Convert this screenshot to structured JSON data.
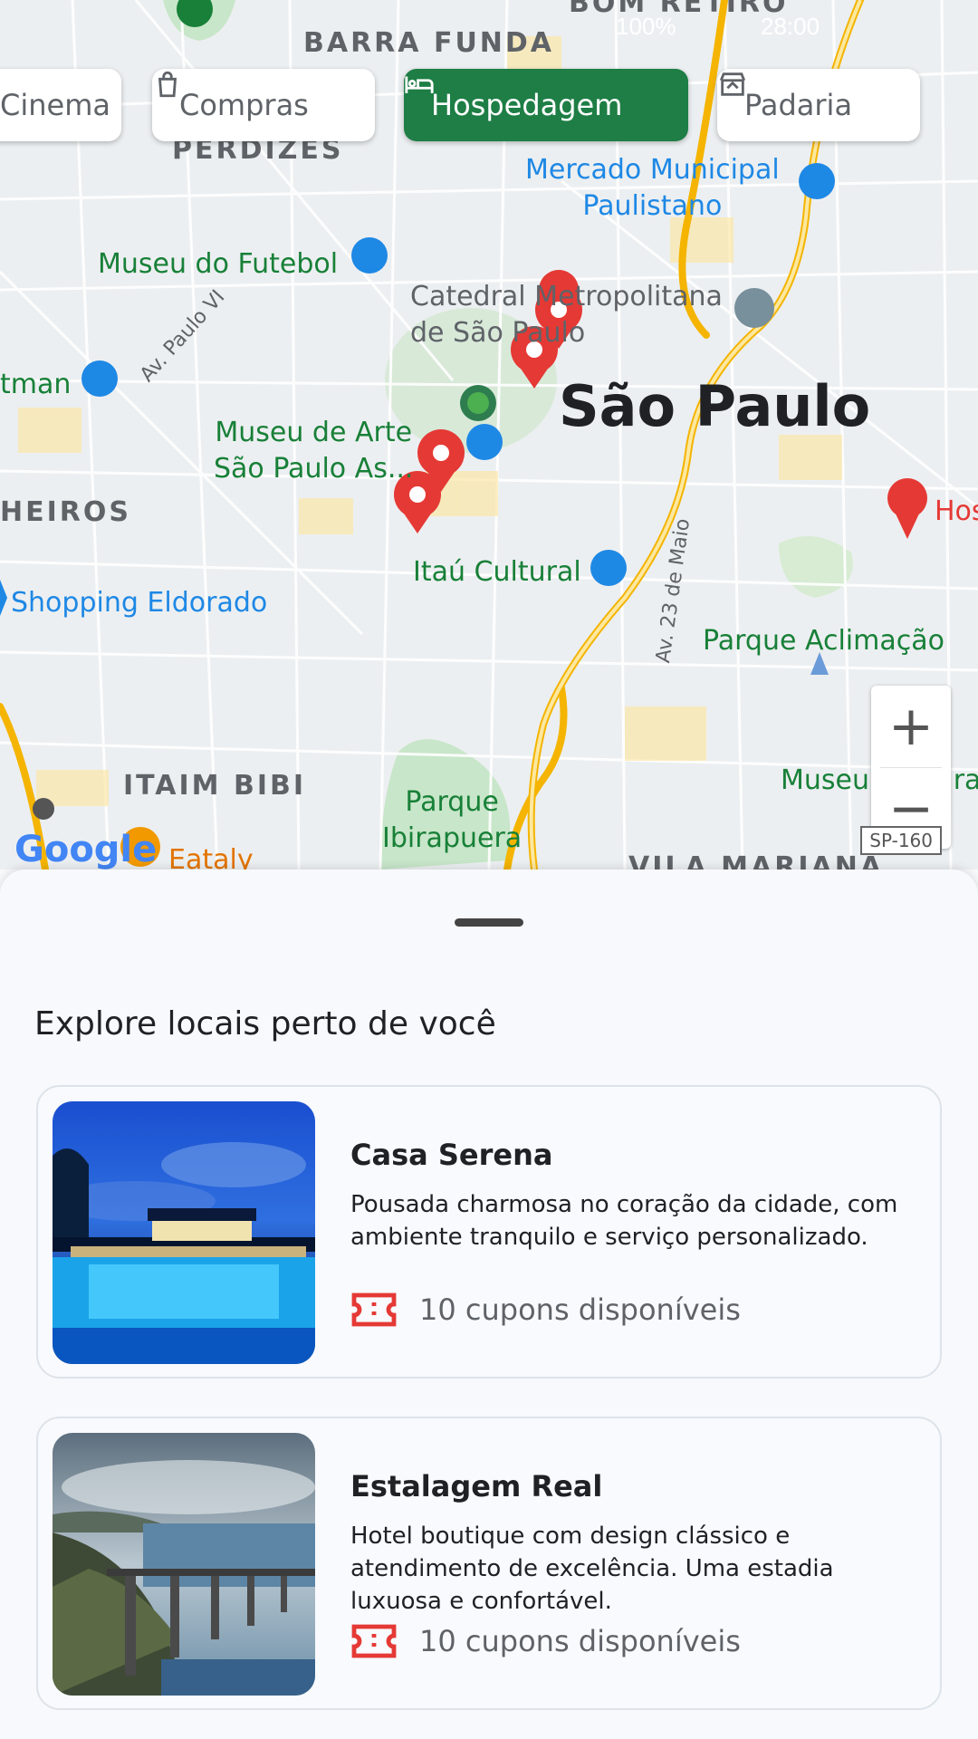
{
  "status_bar": {
    "battery": "100%",
    "time": "28:00"
  },
  "chips": [
    {
      "label": "Cinema",
      "icon": "cinema-icon",
      "active": false
    },
    {
      "label": "Compras",
      "icon": "shopping-bag-icon",
      "active": false
    },
    {
      "label": "Hospedagem",
      "icon": "bed-icon",
      "active": true
    },
    {
      "label": "Padaria",
      "icon": "store-icon",
      "active": false
    }
  ],
  "map": {
    "city": "São Paulo",
    "areas": [
      "BARRA FUNDA",
      "PERDIZES",
      "HEIROS",
      "ITAIM BIBI",
      "VILA MARIANA",
      "BOM RETIRO"
    ],
    "pois": {
      "mercado": "Mercado Municipal\nPaulistano",
      "museu_futebol": "Museu do Futebol",
      "catedral": "Catedral Metropolitana\nde São Paulo",
      "masp": "Museu de Arte\nSão Paulo As...",
      "itau": "Itaú Cultural",
      "shopping": "Shopping Eldorado",
      "aclimacao": "Parque Aclimação",
      "ibirapuera": "Parque\nIbirapuera",
      "eataly": "Eataly",
      "museu_ipiranga": "Museu do Ipira",
      "tman": "tman",
      "hos": "Hos"
    },
    "roads": {
      "paulo_vi": "Av. Paulo VI",
      "23_maio": "Av. 23 de Maio",
      "sp160": "SP-160"
    },
    "attribution": "Google",
    "colors": {
      "park": "#c8e6c9",
      "road_major": "#f9c74f",
      "poi_blue": "#1e88e5",
      "pin": "#e53935"
    }
  },
  "sheet": {
    "title": "Explore locais perto de você",
    "cards": [
      {
        "name": "Casa Serena",
        "description": "Pousada charmosa no coração da cidade, com ambiente tranquilo e serviço personalizado.",
        "coupons": "10 cupons disponíveis"
      },
      {
        "name": "Estalagem Real",
        "description": "Hotel boutique com design clássico e atendimento de excelência. Uma estadia luxuosa e confortável.",
        "coupons": "10 cupons disponíveis"
      }
    ]
  }
}
